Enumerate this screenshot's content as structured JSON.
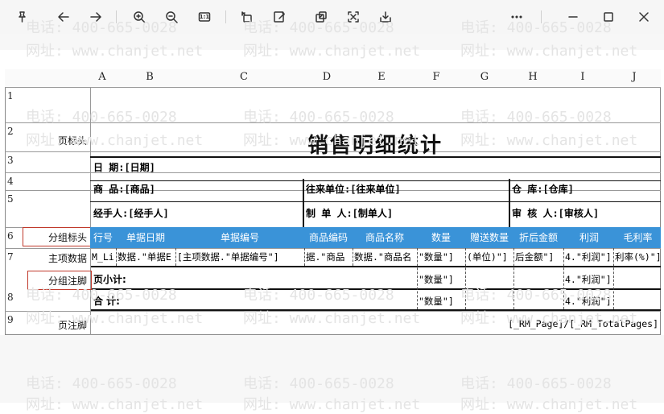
{
  "report": {
    "title": "销售明细统计",
    "columns": [
      "A",
      "B",
      "C",
      "D",
      "E",
      "F",
      "G",
      "H",
      "I",
      "J"
    ],
    "row_numbers": [
      "1",
      "2",
      "3",
      "4",
      "5",
      "6",
      "7",
      "8",
      "9"
    ],
    "row_labels": {
      "r1": "页标头",
      "r5": "分组标头",
      "r6": "主项数据",
      "r7": "分组注脚",
      "r9": "页注脚"
    },
    "fields": {
      "date": "日  期:[日期]",
      "product": "商  品:[商品]",
      "partner": "往来单位:[往来单位]",
      "warehouse": "仓    库:[仓库]",
      "handler": "经手人:[经手人]",
      "maker": "制 单 人:[制单人]",
      "auditor": "审 核 人:[审核人]"
    },
    "grid_headers": [
      "行号",
      "单据日期",
      "单据编号",
      "商品编码",
      "商品名称",
      "数量",
      "赠送数量",
      "折后金额",
      "利润",
      "毛利率"
    ],
    "data_row": [
      "M_Li",
      "数据.\"单据E",
      "[主项数据.\"单据编号\"]",
      "据.\"商品",
      "数据.\"商品名",
      "\"数量\"]",
      "(单位)\"]",
      "后金额\"]",
      "4.\"利润\"]",
      "利率(%)\"]"
    ],
    "subtotal_label": "页小计:",
    "total_label": "合  计:",
    "qty_field": "\"数量\"]",
    "profit_field": "4.\"利润\"]",
    "page_footer": "[_RM_Page]/[_RM_TotalPages]"
  },
  "watermark": {
    "phone": "电话: 400-665-0028",
    "site": "网址: www.chanjet.net"
  },
  "colors": {
    "header_blue": "#3a93d8",
    "highlight_red": "#c0392b",
    "toolbar_bg": "#f6f6f6"
  },
  "toolbar": {
    "icons": [
      "pin-icon",
      "back-icon",
      "forward-icon",
      "zoom-in-icon",
      "zoom-out-icon",
      "actual-size-icon",
      "rotate-icon",
      "edit-icon",
      "copy-icon",
      "crop-icon",
      "save-icon",
      "more-icon",
      "minimize-icon",
      "maximize-icon",
      "close-icon"
    ],
    "actual_size_label": "1:1"
  }
}
